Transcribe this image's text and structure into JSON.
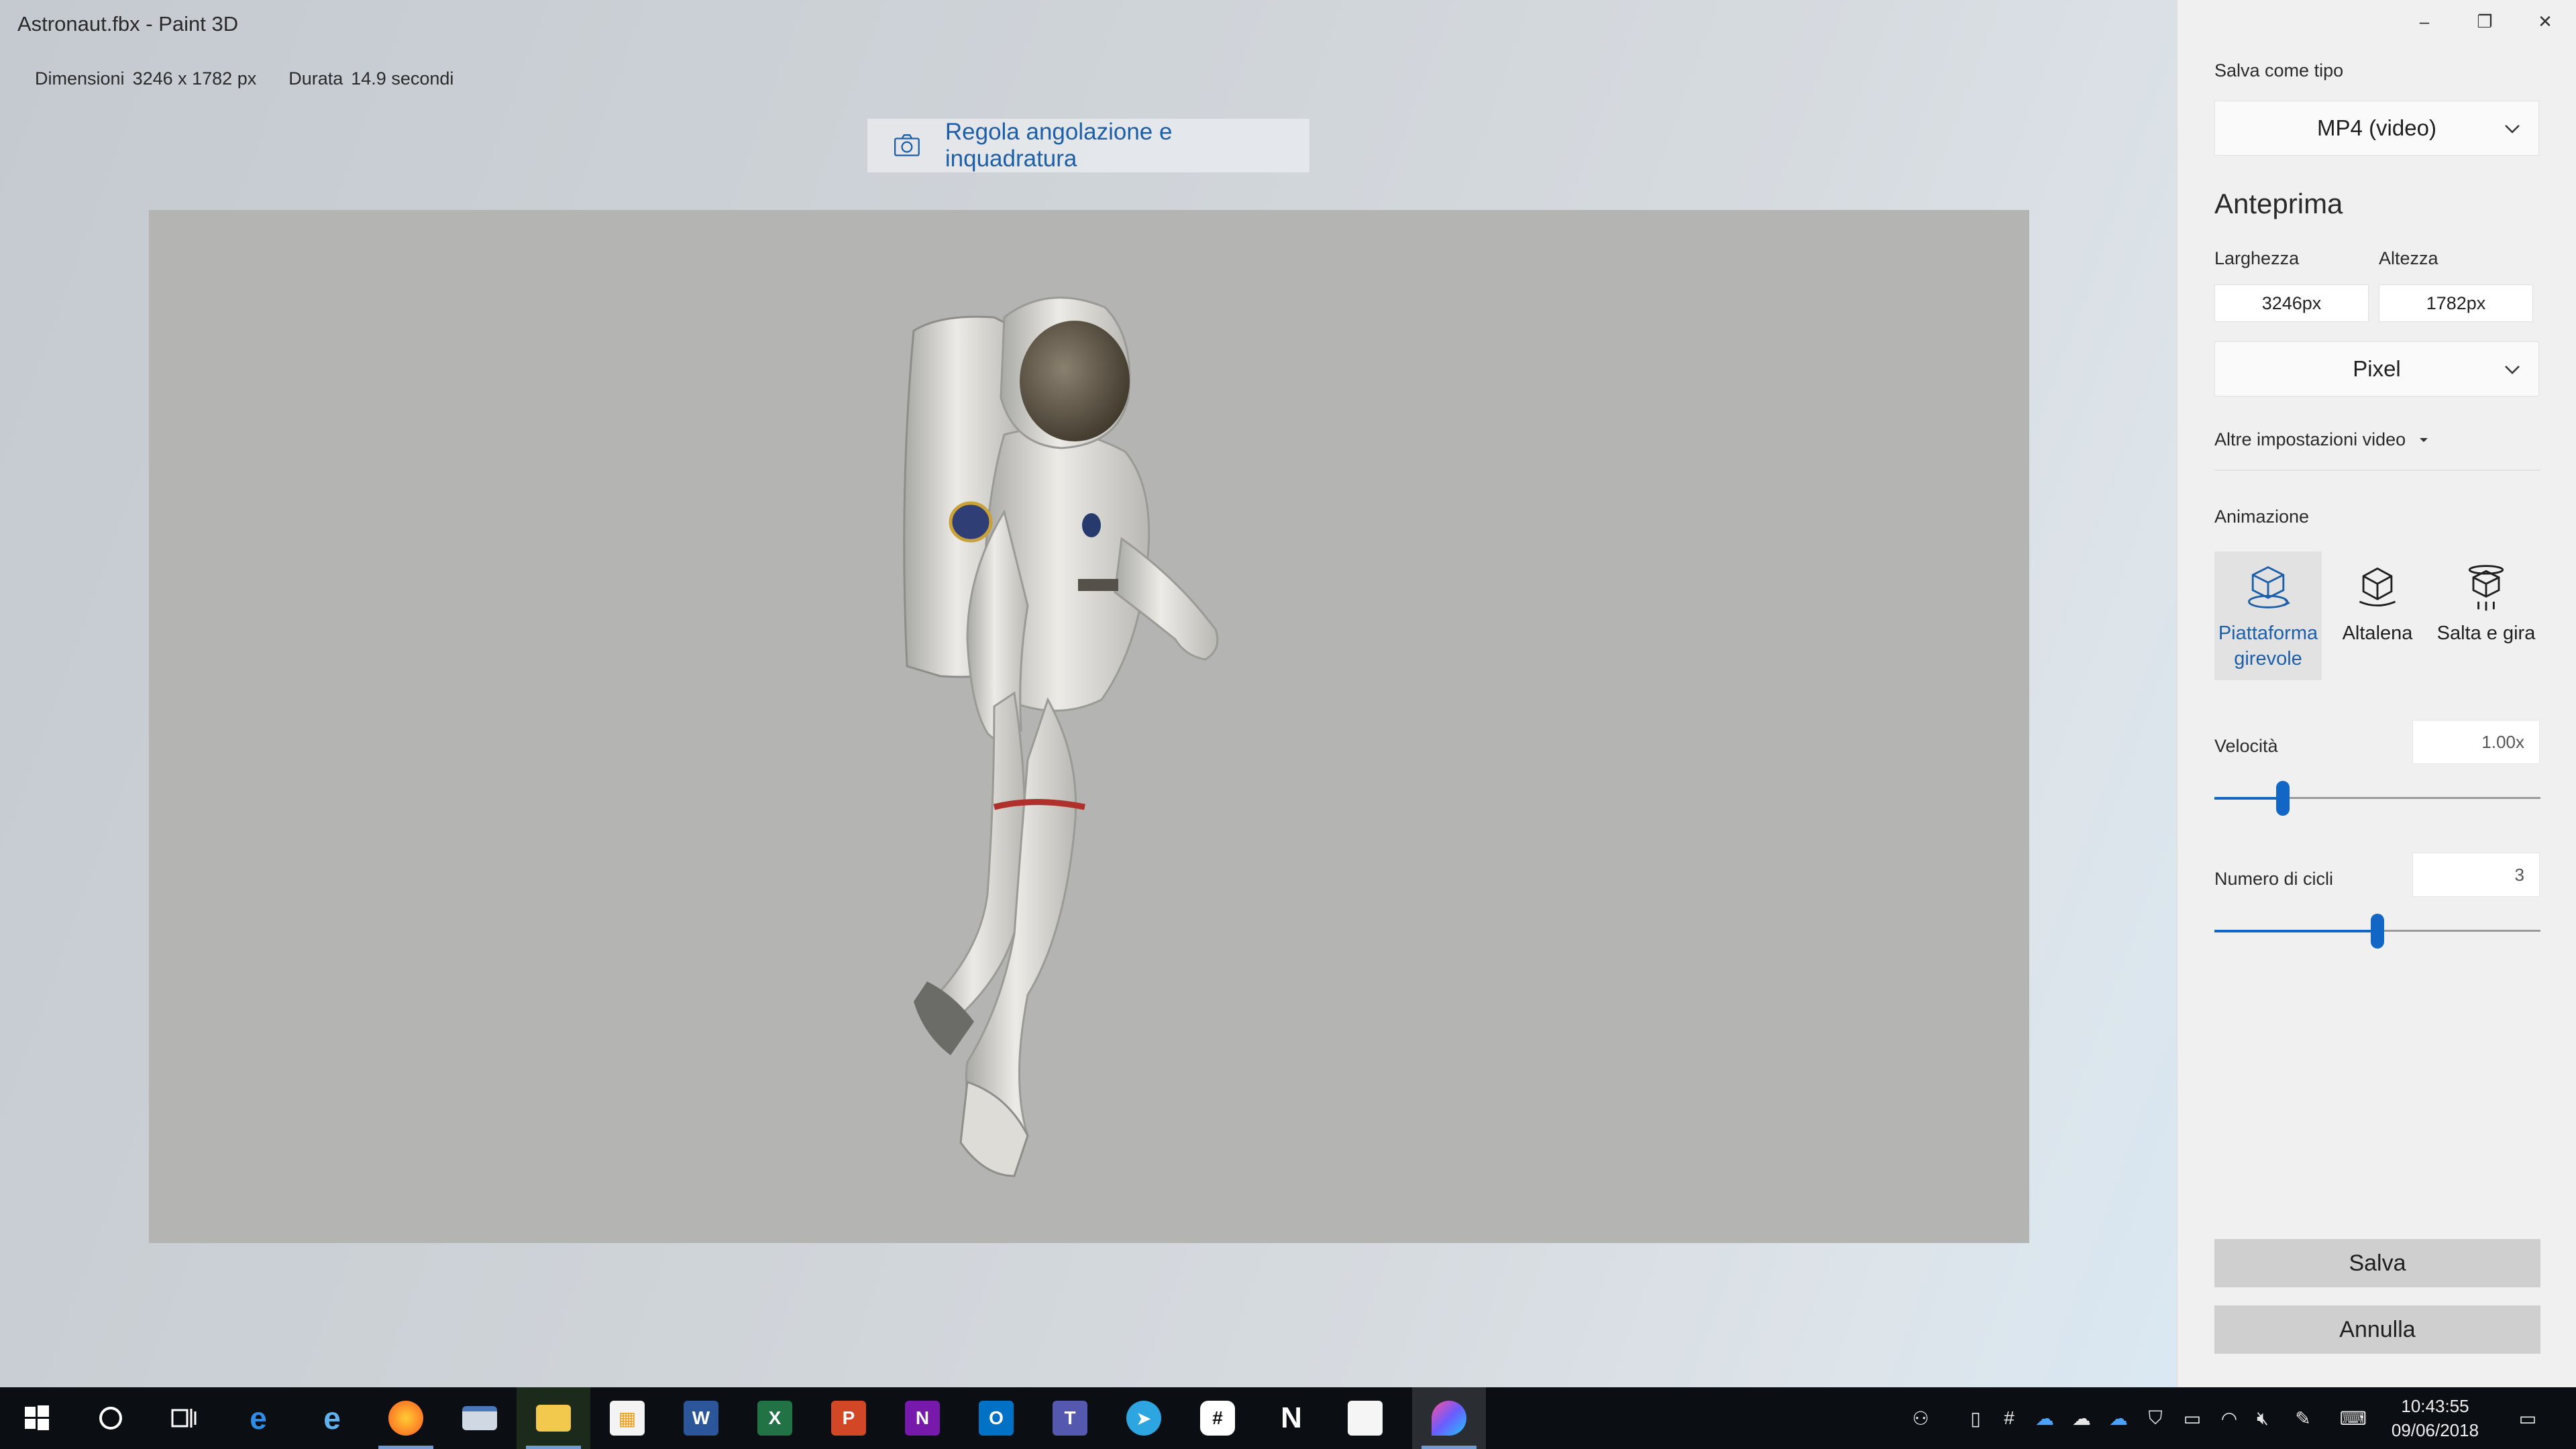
{
  "window": {
    "title": "Astronaut.fbx - Paint 3D",
    "controls": {
      "minimize": "–",
      "restore": "❐",
      "close": "✕"
    }
  },
  "info": {
    "dimensions_label": "Dimensioni",
    "dimensions_value": "3246 x 1782 px",
    "duration_label": "Durata",
    "duration_value": "14.9 secondi"
  },
  "toolbar": {
    "adjust_label": "Regola angolazione e inquadratura",
    "adjust_icon": "camera-icon"
  },
  "panel": {
    "save_as_label": "Salva come tipo",
    "save_as_value": "MP4 (video)",
    "preview_heading": "Anteprima",
    "width_label": "Larghezza",
    "height_label": "Altezza",
    "width_value": "3246px",
    "height_value": "1782px",
    "unit_value": "Pixel",
    "more_video_settings": "Altre impostazioni video",
    "animation_label": "Animazione",
    "animations": [
      {
        "label": "Piattaforma girevole",
        "icon": "turntable-icon",
        "selected": true
      },
      {
        "label": "Altalena",
        "icon": "swing-icon",
        "selected": false
      },
      {
        "label": "Salta e gira",
        "icon": "jump-spin-icon",
        "selected": false
      }
    ],
    "speed_label": "Velocità",
    "speed_value": "1.00x",
    "speed_slider_fraction": 0.21,
    "cycles_label": "Numero di cicli",
    "cycles_value": "3",
    "cycles_slider_fraction": 0.5,
    "save_button": "Salva",
    "cancel_button": "Annulla"
  },
  "taskbar": {
    "apps": [
      "start-icon",
      "cortana-icon",
      "task-view-icon",
      "edge-icon",
      "internet-explorer-icon",
      "firefox-icon",
      "window-app-icon",
      "file-explorer-icon",
      "store-icon",
      "word-icon",
      "excel-icon",
      "powerpoint-icon",
      "onenote-icon",
      "outlook-icon",
      "teams-icon",
      "telegram-icon",
      "slack-icon",
      "notion-icon",
      "snip-icon",
      "paint3d-icon"
    ],
    "time": "10:43:55",
    "date": "09/06/2018"
  },
  "colors": {
    "accent": "#1266c6",
    "link": "#1c5fa8",
    "canvas": "#b4b4b2",
    "taskbar": "#0b0e12"
  }
}
